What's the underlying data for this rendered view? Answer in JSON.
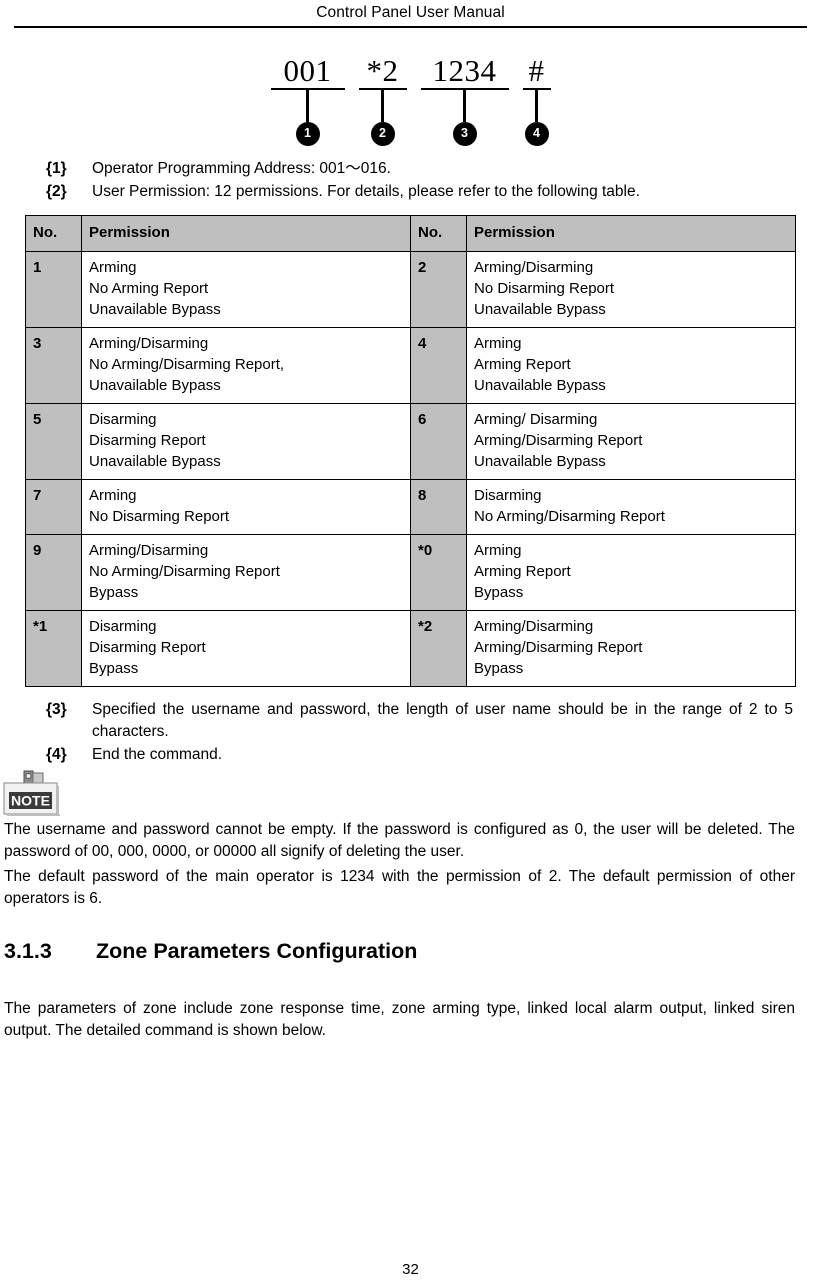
{
  "header": {
    "title": "Control Panel User Manual"
  },
  "syntax_diagram": {
    "tokens": [
      {
        "text": "001",
        "bullet": "1"
      },
      {
        "text": "*2",
        "bullet": "2"
      },
      {
        "text": "1234",
        "bullet": "3"
      },
      {
        "text": "#",
        "bullet": "4"
      }
    ]
  },
  "notes_top": [
    {
      "marker": "{1}",
      "text": "Operator Programming Address: 001～016."
    },
    {
      "marker": "{2}",
      "text": "User Permission: 12 permissions. For details, please refer to the following table."
    }
  ],
  "permission_table": {
    "headers": [
      "No.",
      "Permission",
      "No.",
      "Permission"
    ],
    "rows": [
      {
        "left_no": "1",
        "left_lines": [
          "Arming",
          "No Arming Report",
          "Unavailable Bypass"
        ],
        "right_no": "2",
        "right_lines": [
          "Arming/Disarming",
          "No Disarming Report",
          "Unavailable Bypass"
        ]
      },
      {
        "left_no": "3",
        "left_lines": [
          "Arming/Disarming",
          "No Arming/Disarming Report,",
          "Unavailable Bypass"
        ],
        "right_no": "4",
        "right_lines": [
          "Arming",
          "Arming Report",
          "Unavailable Bypass"
        ]
      },
      {
        "left_no": "5",
        "left_lines": [
          "Disarming",
          "Disarming Report",
          "Unavailable Bypass"
        ],
        "right_no": "6",
        "right_lines": [
          "Arming/ Disarming",
          "Arming/Disarming Report",
          "Unavailable Bypass"
        ]
      },
      {
        "left_no": "7",
        "left_lines": [
          "Arming",
          "No Disarming Report"
        ],
        "right_no": "8",
        "right_lines": [
          "Disarming",
          "No Arming/Disarming Report"
        ]
      },
      {
        "left_no": "9",
        "left_lines": [
          "Arming/Disarming",
          "No Arming/Disarming Report",
          "Bypass"
        ],
        "right_no": "*0",
        "right_lines": [
          "Arming",
          "Arming Report",
          "Bypass"
        ]
      },
      {
        "left_no": "*1",
        "left_lines": [
          "Disarming",
          "Disarming Report",
          "Bypass"
        ],
        "right_no": "*2",
        "right_lines": [
          "Arming/Disarming",
          "Arming/Disarming Report",
          "Bypass"
        ]
      }
    ]
  },
  "notes_bottom": [
    {
      "marker": "{3}",
      "text": "Specified the username and password, the length of user name should be in the range of 2 to 5 characters."
    },
    {
      "marker": "{4}",
      "text": "End the command."
    }
  ],
  "note_box": {
    "icon_label": "NOTE",
    "paragraphs": [
      "The username and password cannot be empty. If the password is configured as 0, the user will be deleted. The password of 00, 000, 0000, or 00000 all signify of deleting the user.",
      "The default password of the main operator is 1234 with the permission of 2. The default permission of other operators is 6."
    ]
  },
  "section": {
    "number": "3.1.3",
    "title": "Zone Parameters Configuration",
    "body": "The parameters of zone include zone response time, zone arming type, linked local alarm output, linked siren output. The detailed command is shown below."
  },
  "footer": {
    "page_number": "32"
  },
  "colors": {
    "table_gray": "#bfbfbf",
    "text": "#000000",
    "rule": "#000000"
  }
}
